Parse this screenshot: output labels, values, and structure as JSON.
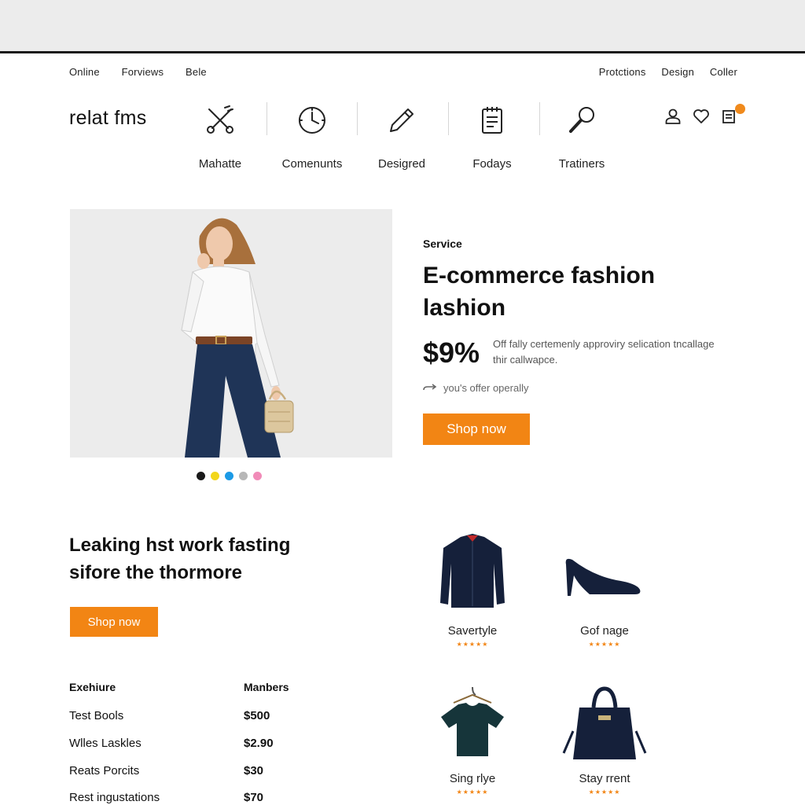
{
  "top_nav_left": [
    "Online",
    "Forviews",
    "Bele"
  ],
  "top_nav_right": [
    "Protctions",
    "Design",
    "Coller"
  ],
  "logo": "relat fms",
  "categories": [
    {
      "label": "Mahatte",
      "icon": "scissors-icon"
    },
    {
      "label": "Comenunts",
      "icon": "clock-icon"
    },
    {
      "label": "Desigred",
      "icon": "pencil-icon"
    },
    {
      "label": "Fodays",
      "icon": "clipboard-icon"
    },
    {
      "label": "Tratiners",
      "icon": "magnifier-icon"
    }
  ],
  "utility_icons": [
    "user-icon",
    "heart-icon",
    "cart-icon"
  ],
  "hero": {
    "eyebrow": "Service",
    "title": "E-commerce fashion lashion",
    "price": "$9%",
    "description": "Off fally certemenly approviry selication tncallage thir callwapce.",
    "offer": "you's offer operally",
    "cta": "Shop now",
    "swatch_colors": [
      "#1a1a1a",
      "#f2d61c",
      "#1c9ae6",
      "#b7b7b7",
      "#f18bb8"
    ]
  },
  "promo": {
    "title": "Leaking hst work fasting sifore the thormore",
    "cta": "Shop now"
  },
  "table": {
    "headers": [
      "Exehiure",
      "Manbers"
    ],
    "rows": [
      [
        "Test Bools",
        "$500"
      ],
      [
        "Wlles Laskles",
        "$2.90"
      ],
      [
        "Reats Porcits",
        "$30"
      ],
      [
        "Rest ingustations",
        "$70"
      ]
    ]
  },
  "products": [
    {
      "name": "Savertyle",
      "rating": 5,
      "icon": "shirt-icon"
    },
    {
      "name": "Gof nage",
      "rating": 5,
      "icon": "heel-shoe-icon"
    },
    {
      "name": "Sing rlye",
      "rating": 5,
      "icon": "tshirt-icon"
    },
    {
      "name": "Stay rrent",
      "rating": 5,
      "icon": "handbag-icon"
    }
  ],
  "colors": {
    "accent": "#f28514",
    "navy": "#15203a"
  }
}
